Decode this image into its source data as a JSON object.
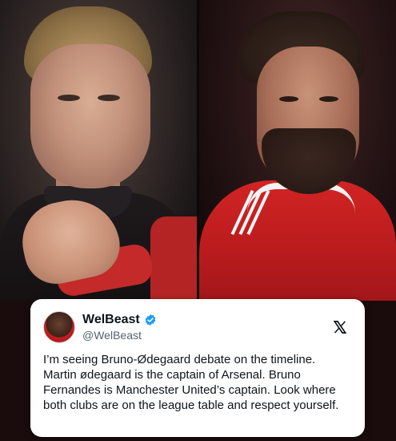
{
  "tweet": {
    "display_name": "WelBeast",
    "handle": "@WelBeast",
    "verified_icon": "verified-badge-icon",
    "platform_icon": "x-logo-icon",
    "text": "I’m seeing Bruno-Ødegaard debate on the timeline.\nMartin ødegaard is the captain of Arsenal. Bruno Fernandes is Manchester United’s captain. Look where both clubs are on the league table and respect yourself."
  },
  "colors": {
    "verified": "#1d9bf0",
    "arsenal_red": "#c42a2a",
    "united_red": "#d22424",
    "card_bg": "#ffffff",
    "text": "#0f1419",
    "subtle": "#536471"
  }
}
